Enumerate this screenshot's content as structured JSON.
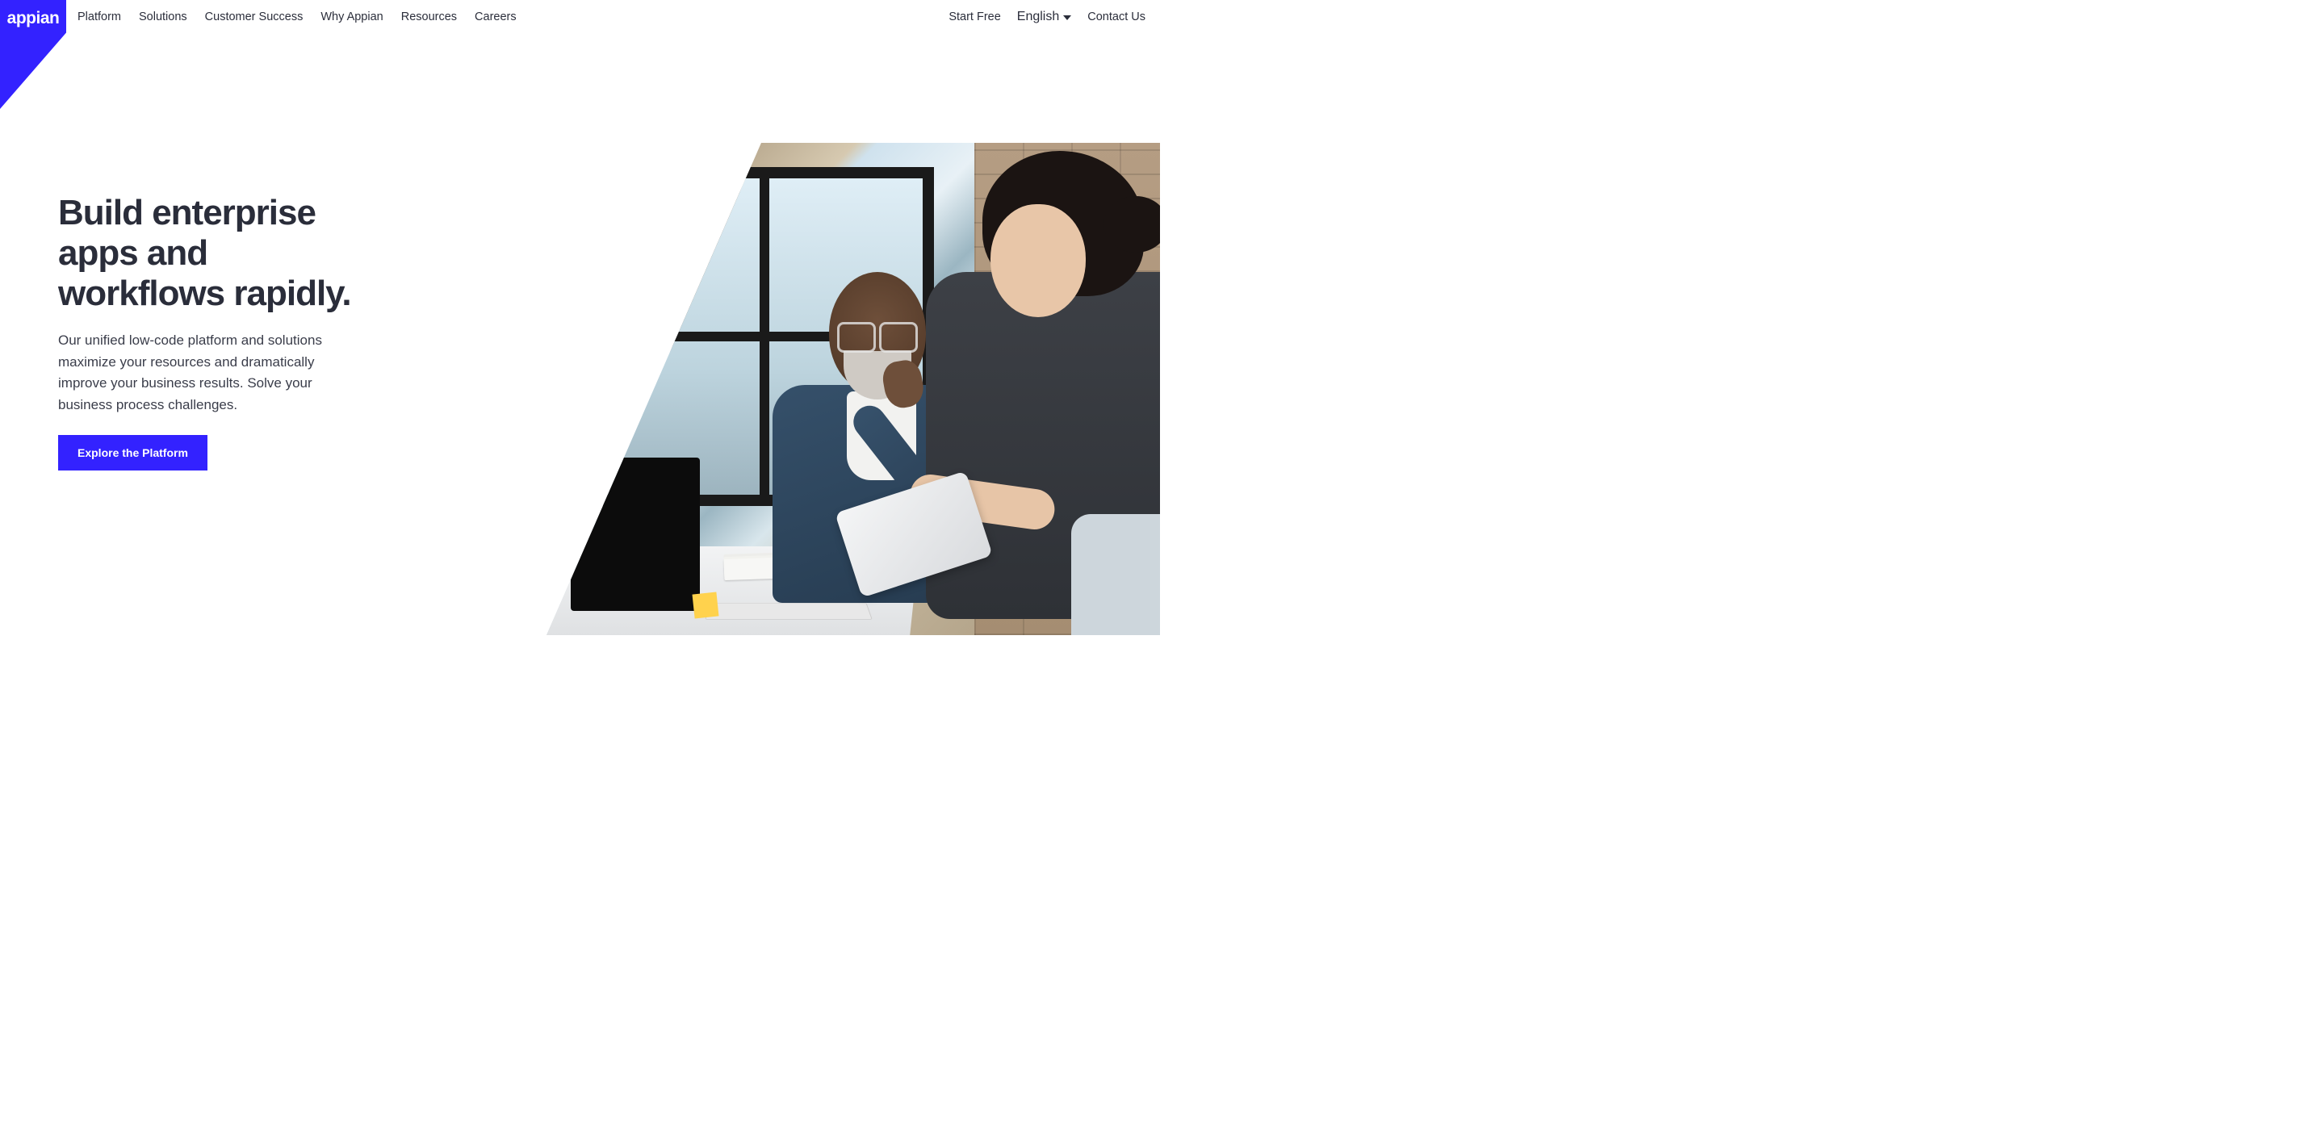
{
  "brand": {
    "name": "appian"
  },
  "nav": {
    "items": [
      {
        "label": "Platform"
      },
      {
        "label": "Solutions"
      },
      {
        "label": "Customer Success"
      },
      {
        "label": "Why Appian"
      },
      {
        "label": "Resources"
      },
      {
        "label": "Careers"
      }
    ]
  },
  "actions": {
    "start_free": "Start Free",
    "language": "English",
    "contact": "Contact Us"
  },
  "hero": {
    "title": "Build enterprise apps and workflows rapidly.",
    "subtitle": "Our unified low-code platform and solutions maximize your resources and dramatically improve your business results. Solve your business process challenges.",
    "cta": "Explore the Platform",
    "image_alt": "Two colleagues collaborating with a tablet in an office with a brick wall and large window"
  },
  "colors": {
    "brand_blue": "#3322ff",
    "text_primary": "#2b2e3b"
  }
}
